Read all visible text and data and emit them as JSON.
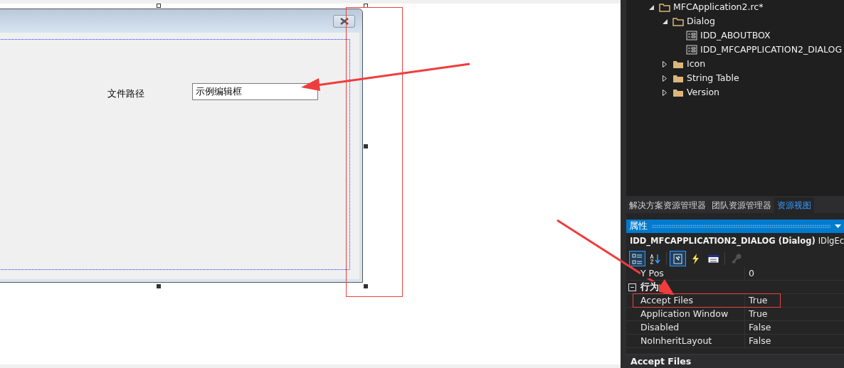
{
  "dialog": {
    "label": "文件路径",
    "edit_value": "示例编辑框"
  },
  "resource_tree": [
    {
      "kind": "file",
      "label": "MFCApplication2.rc*",
      "expanded": true,
      "children": [
        {
          "kind": "folder",
          "label": "Dialog",
          "expanded": true,
          "children": [
            {
              "kind": "resource",
              "label": "IDD_ABOUTBOX"
            },
            {
              "kind": "resource",
              "label": "IDD_MFCAPPLICATION2_DIALOG"
            }
          ]
        },
        {
          "kind": "folder",
          "label": "Icon",
          "expanded": false
        },
        {
          "kind": "folder",
          "label": "String Table",
          "expanded": false
        },
        {
          "kind": "folder",
          "label": "Version",
          "expanded": false
        }
      ]
    }
  ],
  "tabs": [
    {
      "label": "解决方案资源管理器",
      "selected": false
    },
    {
      "label": "团队资源管理器",
      "selected": false
    },
    {
      "label": "资源视图",
      "selected": true
    }
  ],
  "properties": {
    "title": "属性",
    "object": "IDD_MFCAPPLICATION2_DIALOG (Dialog)",
    "object_class": "IDlgEc",
    "toolbar": [
      {
        "kind": "categorized",
        "selected": true,
        "disabled": false
      },
      {
        "kind": "alphabetical",
        "selected": false,
        "disabled": false
      },
      {
        "kind": "properties",
        "selected": true,
        "disabled": false
      },
      {
        "kind": "events",
        "selected": false,
        "disabled": false
      },
      {
        "kind": "messages",
        "selected": false,
        "disabled": false
      },
      {
        "kind": "overrides",
        "selected": false,
        "disabled": true
      }
    ],
    "rows": [
      {
        "kind": "property",
        "name": "Y Pos",
        "value": "0",
        "highlighted": false
      },
      {
        "kind": "category",
        "name": "行为",
        "expanded": true
      },
      {
        "kind": "property",
        "name": "Accept Files",
        "value": "True",
        "highlighted": true
      },
      {
        "kind": "property",
        "name": "Application Window",
        "value": "True",
        "highlighted": false
      },
      {
        "kind": "property",
        "name": "Disabled",
        "value": "False",
        "highlighted": false
      },
      {
        "kind": "property",
        "name": "NoInheritLayout",
        "value": "False",
        "highlighted": false
      }
    ],
    "description_title": "Accept Files"
  }
}
